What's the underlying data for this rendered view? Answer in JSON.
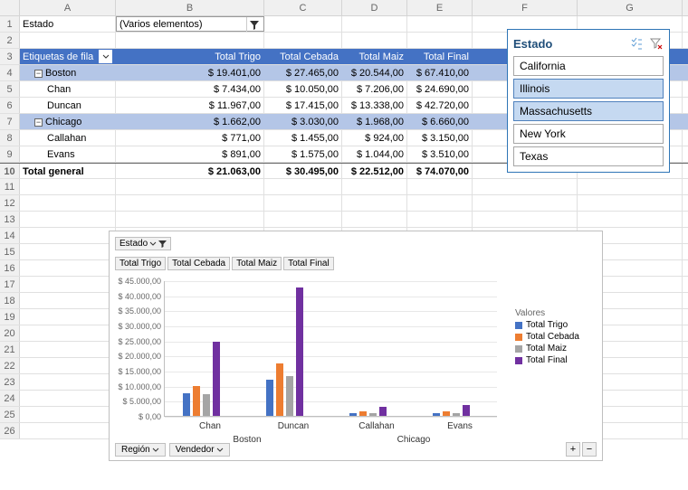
{
  "columns": [
    "A",
    "B",
    "C",
    "D",
    "E",
    "F",
    "G"
  ],
  "rows_count": 26,
  "filter_row": {
    "label": "Estado",
    "value": "(Varios elementos)"
  },
  "pivot_header": {
    "rowlabel": "Etiquetas de fila",
    "cols": [
      "Total Trigo",
      "Total Cebada",
      "Total  Maiz",
      "Total Final"
    ]
  },
  "pivot_rows": [
    {
      "type": "group",
      "label": "Boston",
      "vals": [
        "$ 19.401,00",
        "$ 27.465,00",
        "$ 20.544,00",
        "$ 67.410,00"
      ]
    },
    {
      "type": "item",
      "label": "Chan",
      "vals": [
        "$ 7.434,00",
        "$ 10.050,00",
        "$ 7.206,00",
        "$ 24.690,00"
      ]
    },
    {
      "type": "item",
      "label": "Duncan",
      "vals": [
        "$ 11.967,00",
        "$ 17.415,00",
        "$ 13.338,00",
        "$ 42.720,00"
      ]
    },
    {
      "type": "group",
      "label": "Chicago",
      "vals": [
        "$ 1.662,00",
        "$ 3.030,00",
        "$ 1.968,00",
        "$ 6.660,00"
      ]
    },
    {
      "type": "item",
      "label": "Callahan",
      "vals": [
        "$ 771,00",
        "$ 1.455,00",
        "$ 924,00",
        "$ 3.150,00"
      ]
    },
    {
      "type": "item",
      "label": "Evans",
      "vals": [
        "$ 891,00",
        "$ 1.575,00",
        "$ 1.044,00",
        "$ 3.510,00"
      ]
    }
  ],
  "grand_total": {
    "label": "Total general",
    "vals": [
      "$ 21.063,00",
      "$ 30.495,00",
      "$ 22.512,00",
      "$ 74.070,00"
    ]
  },
  "slicer": {
    "title": "Estado",
    "items": [
      {
        "label": "California",
        "sel": false
      },
      {
        "label": "Illinois",
        "sel": true
      },
      {
        "label": "Massachusetts",
        "sel": true
      },
      {
        "label": "New York",
        "sel": false
      },
      {
        "label": "Texas",
        "sel": false
      }
    ]
  },
  "chart_data": {
    "type": "bar",
    "title": "",
    "ylabel": "",
    "ylim": [
      0,
      45000
    ],
    "ystep": 5000,
    "yticks": [
      "$ 0,00",
      "$ 5.000,00",
      "$ 10.000,00",
      "$ 15.000,00",
      "$ 20.000,00",
      "$ 25.000,00",
      "$ 30.000,00",
      "$ 35.000,00",
      "$ 40.000,00",
      "$ 45.000,00"
    ],
    "groups": [
      {
        "region": "Boston",
        "items": [
          "Chan",
          "Duncan"
        ]
      },
      {
        "region": "Chicago",
        "items": [
          "Callahan",
          "Evans"
        ]
      }
    ],
    "categories": [
      "Chan",
      "Duncan",
      "Callahan",
      "Evans"
    ],
    "series": [
      {
        "name": "Total Trigo",
        "values": [
          7434,
          11967,
          771,
          891
        ],
        "color": "#4472c4"
      },
      {
        "name": "Total Cebada",
        "values": [
          10050,
          17415,
          1455,
          1575
        ],
        "color": "#ed7d31"
      },
      {
        "name": "Total  Maiz",
        "values": [
          7206,
          13338,
          924,
          1044
        ],
        "color": "#a5a5a5"
      },
      {
        "name": "Total Final",
        "values": [
          24690,
          42720,
          3150,
          3510
        ],
        "color": "#7030a0"
      }
    ],
    "legend_title": "Valores",
    "filter_field": "Estado",
    "value_buttons": [
      "Total Trigo",
      "Total Cebada",
      "Total  Maiz",
      "Total Final"
    ],
    "bottom_fields": [
      "Región",
      "Vendedor"
    ]
  }
}
